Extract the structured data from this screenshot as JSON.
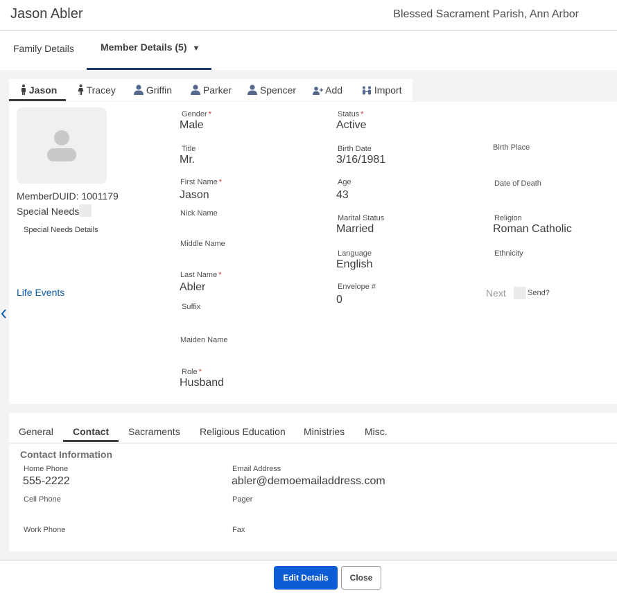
{
  "header": {
    "name": "Jason Abler",
    "parish": "Blessed Sacrament Parish, Ann Arbor"
  },
  "top_tabs": [
    {
      "label": "Family Details"
    },
    {
      "label": "Member Details (5)",
      "caret": "▼"
    }
  ],
  "member_tabs": [
    {
      "label": "Jason",
      "icon": "male-person-icon"
    },
    {
      "label": "Tracey",
      "icon": "female-person-icon"
    },
    {
      "label": "Griffin",
      "icon": "person-icon"
    },
    {
      "label": "Parker",
      "icon": "person-icon"
    },
    {
      "label": "Spencer",
      "icon": "person-icon"
    },
    {
      "label": "Add",
      "icon": "add-person-icon"
    },
    {
      "label": "Import",
      "icon": "import-people-icon"
    }
  ],
  "profile": {
    "duid": "MemberDUID: 1001179",
    "special_needs": "Special Needs",
    "special_needs_details": "Special Needs Details",
    "life_events": "Life Events"
  },
  "fields": {
    "gender": {
      "label": "Gender",
      "value": "Male",
      "required": "*"
    },
    "title": {
      "label": "Title",
      "value": "Mr."
    },
    "first_name": {
      "label": "First Name",
      "value": "Jason",
      "required": "*"
    },
    "nick_name": {
      "label": "Nick Name",
      "value": ""
    },
    "middle_name": {
      "label": "Middle Name",
      "value": ""
    },
    "last_name": {
      "label": "Last Name",
      "value": "Abler",
      "required": "*"
    },
    "suffix": {
      "label": "Suffix",
      "value": ""
    },
    "maiden_name": {
      "label": "Maiden Name",
      "value": ""
    },
    "role": {
      "label": "Role",
      "value": "Husband",
      "required": "*"
    },
    "status": {
      "label": "Status",
      "value": "Active",
      "required": "*"
    },
    "birth_date": {
      "label": "Birth Date",
      "value": "3/16/1981"
    },
    "age": {
      "label": "Age",
      "value": "43"
    },
    "marital_status": {
      "label": "Marital Status",
      "value": "Married"
    },
    "language": {
      "label": "Language",
      "value": "English"
    },
    "envelope": {
      "label": "Envelope #",
      "value": "0"
    },
    "birth_place": {
      "label": "Birth Place",
      "value": ""
    },
    "date_of_death": {
      "label": "Date of Death",
      "value": ""
    },
    "religion": {
      "label": "Religion",
      "value": "Roman Catholic"
    },
    "ethnicity": {
      "label": "Ethnicity",
      "value": ""
    },
    "next_label": "Next",
    "send_label": "Send?"
  },
  "sub_tabs": [
    {
      "label": "General"
    },
    {
      "label": "Contact"
    },
    {
      "label": "Sacraments"
    },
    {
      "label": "Religious Education"
    },
    {
      "label": "Ministries"
    },
    {
      "label": "Misc."
    }
  ],
  "contact": {
    "title": "Contact Information",
    "home_phone": {
      "label": "Home Phone",
      "value": "555-2222"
    },
    "cell_phone": {
      "label": "Cell Phone",
      "value": ""
    },
    "work_phone": {
      "label": "Work Phone",
      "value": ""
    },
    "email": {
      "label": "Email Address",
      "value": "abler@demoemailaddress.com"
    },
    "pager": {
      "label": "Pager",
      "value": ""
    },
    "fax": {
      "label": "Fax",
      "value": ""
    }
  },
  "footer": {
    "edit_label": "Edit Details",
    "close_label": "Close"
  },
  "colors": {
    "accent": "#0b5cd5",
    "link": "#0b5cab",
    "required": "#c23934",
    "tab_underline": "#1b3a6b"
  }
}
